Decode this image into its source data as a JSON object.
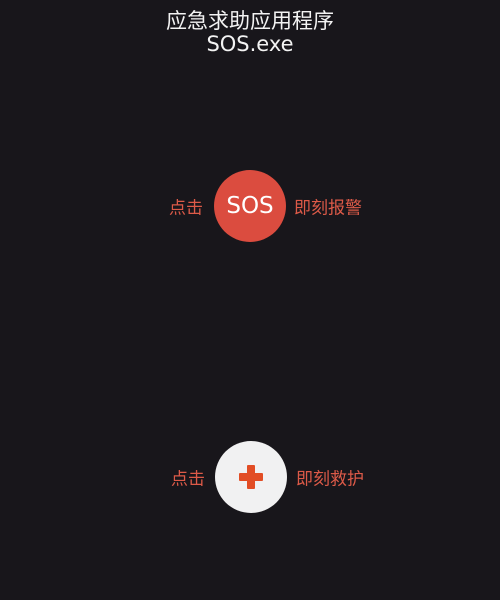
{
  "header": {
    "title": "应急求助应用程序",
    "subtitle": "SOS.exe"
  },
  "sos_action": {
    "left_label": "点击",
    "button_label": "SOS",
    "right_label": "即刻报警",
    "button_color": "#db4c3f",
    "label_color": "#dd5a48"
  },
  "help_action": {
    "left_label": "点击",
    "icon": "plus-icon",
    "right_label": "即刻救护",
    "button_color": "#f1f1f2",
    "icon_color": "#e24d25",
    "label_color": "#dd5a48"
  },
  "theme": {
    "background": "#18161b",
    "title_color": "#f3f3f3"
  }
}
